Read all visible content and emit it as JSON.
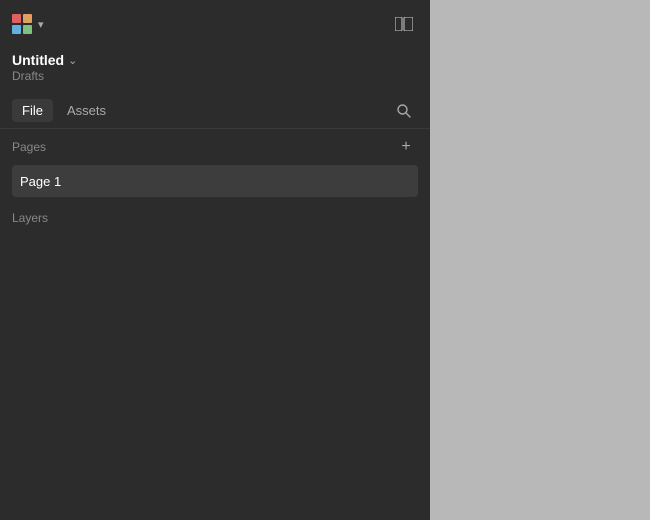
{
  "topbar": {
    "logo_label": "App Logo",
    "chevron": "▾",
    "panel_toggle": "⬜"
  },
  "file": {
    "title": "Untitled",
    "title_chevron": "⌄",
    "subtitle": "Drafts"
  },
  "tabs": {
    "file_label": "File",
    "assets_label": "Assets",
    "active": "File"
  },
  "pages": {
    "section_label": "Pages",
    "add_label": "+",
    "items": [
      {
        "name": "Page 1"
      }
    ]
  },
  "layers": {
    "section_label": "Layers"
  }
}
